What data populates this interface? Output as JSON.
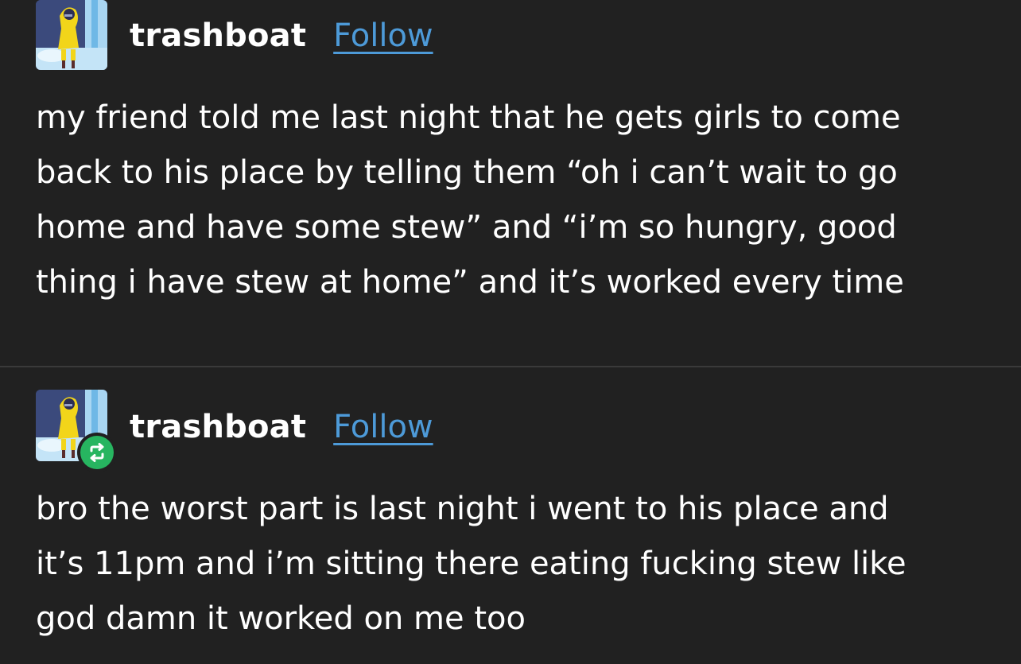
{
  "colors": {
    "background": "#212121",
    "divider": "#3a3a3a",
    "text": "#ffffff",
    "follow_link": "#4d9ad8",
    "reblog_badge": "#27b560"
  },
  "posts": [
    {
      "username": "trashboat",
      "follow_label": "Follow",
      "avatar_icon": "yellow-raincoat-avatar",
      "lines": [
        "my friend told me last night that he gets girls to come",
        "back to his place by telling them “oh i can’t wait to go",
        "home and have some stew” and “i’m so hungry, good",
        "thing i have stew at home” and it’s worked every time"
      ]
    },
    {
      "username": "trashboat",
      "follow_label": "Follow",
      "avatar_icon": "yellow-raincoat-avatar",
      "badge_icon": "reblog-icon",
      "lines": [
        "bro the worst part is last night i went to his place and",
        "it’s 11pm and i’m sitting there eating fucking stew like",
        "god damn it worked on me too"
      ]
    }
  ]
}
